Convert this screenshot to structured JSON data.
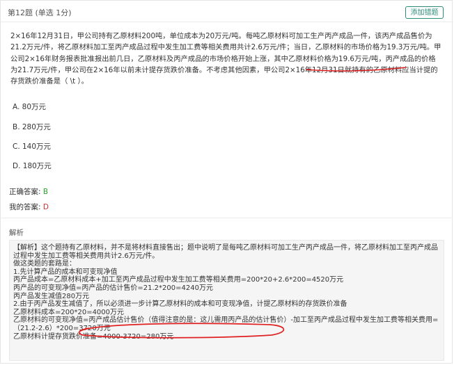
{
  "question": {
    "title": "第12题 (单选 1分)",
    "add_button": "添加错题",
    "stem": "2×16年12月31日，甲公司持有乙原材料200吨，单位成本为20万元/吨。每吨乙原材料可加工生产丙产成品一件，该丙产成品售价为21.2万元/件，将乙原材料加工至丙产成品过程中发生加工费等相关费用共计2.6万元/件；当日，乙原材料的市场价格为19.3万元/吨。甲公司2×16年财务报表批准报出前几日，乙原材料及丙产成品的市场价格开始上涨，其中乙原材料价格为19.6万元/吨，丙产成品的价格为21.7万元/件，甲公司在2×16年以前未计提存货跌价准备。不考虑其他因素，甲公司2×16年12月31日就持有的乙原材料应当计提的存货跌价准备是（ \\t ）。"
  },
  "options": [
    {
      "label": "A. 80万元"
    },
    {
      "label": "B. 280万元"
    },
    {
      "label": "C. 140万元"
    },
    {
      "label": "D. 180万元"
    }
  ],
  "answers": {
    "correct_label": "正确答案:",
    "correct_value": "B",
    "mine_label": "我的答案:",
    "mine_value": "D"
  },
  "analysis": {
    "heading": "解析",
    "lines": [
      "【解析】这个题持有乙原材料，并不是将材料直接售出；题中说明了是每吨乙原材料可加工生产丙产成品一件，将乙原材料加工至丙产成品过程中发生加工费等相关费用共计2.6万元/件。",
      "做这类题的套路是：",
      "1.先计算产品的成本和可变现净值",
      "丙产品成本=乙原材料成本+加工至丙产成品过程中发生加工费等相关费用=200*20+2.6*200=4520万元",
      "丙产品的可变现净值=丙产品的估计售价=21.2*200=4240万元",
      "丙产品发生减值280万元",
      "2.由于丙产品发生减值了，所以必须进一步计算乙原材料的成本和可变现净值，计提乙原材料的存货跌价准备",
      "乙原材料成本=200*20=4000万元",
      "乙原材料的可变现净值=丙产成品估计售价（值得注意的是：这儿需用丙产品的估计售价）-加工至丙产成品过程中发生加工费等相关费用=（21.2-2.6）*200=3720万元",
      "乙原材料计提存货跌价准备=4000-3720=280万元"
    ]
  },
  "colors": {
    "accent": "#2c8c7a",
    "correct": "#2ca02c",
    "wrong": "#d0312d",
    "annotation": "#e02020"
  }
}
